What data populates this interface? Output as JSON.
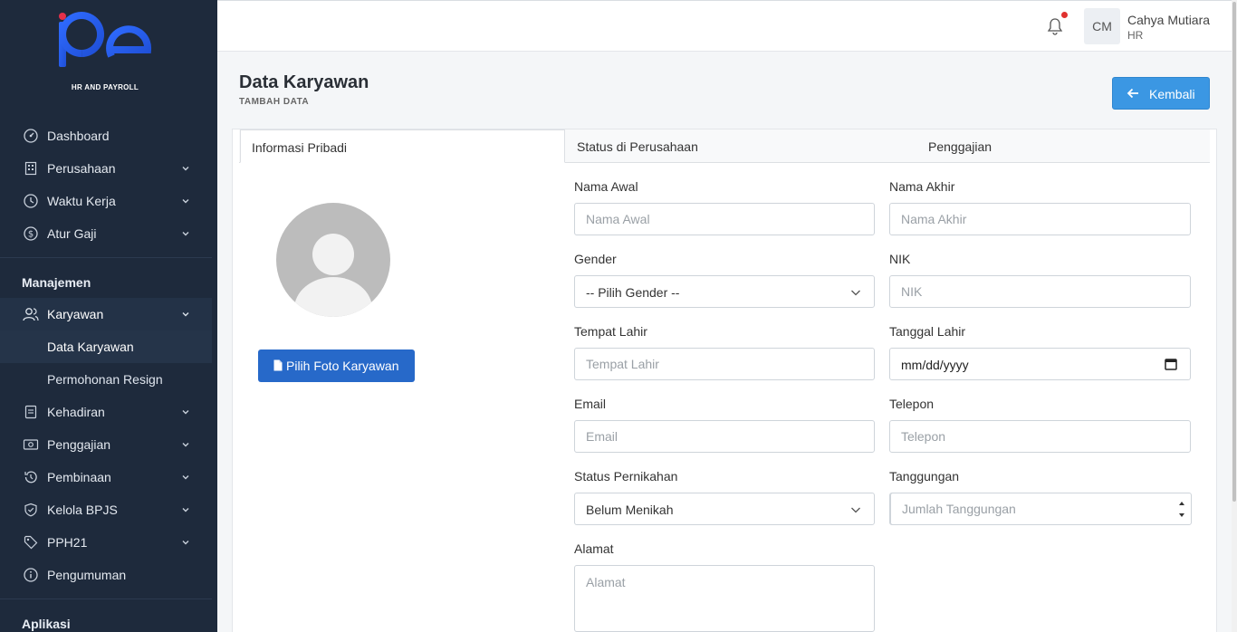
{
  "brand": {
    "logo_text": "be",
    "tagline": "HR AND PAYROLL",
    "accent": "#2563eb"
  },
  "sidebar": {
    "items": [
      {
        "label": "Dashboard",
        "icon": "dashboard-icon"
      },
      {
        "label": "Perusahaan",
        "icon": "building-icon"
      },
      {
        "label": "Waktu Kerja",
        "icon": "clock-icon"
      },
      {
        "label": "Atur Gaji",
        "icon": "dollar-icon"
      }
    ],
    "section_manajemen": "Manajemen",
    "manajemen_items": [
      {
        "label": "Karyawan",
        "icon": "users-icon"
      }
    ],
    "karyawan_sub": [
      {
        "label": "Data Karyawan"
      },
      {
        "label": "Permohonan Resign"
      }
    ],
    "more_items": [
      {
        "label": "Kehadiran",
        "icon": "clipboard-icon"
      },
      {
        "label": "Penggajian",
        "icon": "money-icon"
      },
      {
        "label": "Pembinaan",
        "icon": "history-icon"
      },
      {
        "label": "Kelola BPJS",
        "icon": "shield-icon"
      },
      {
        "label": "PPH21",
        "icon": "tag-icon"
      },
      {
        "label": "Pengumuman",
        "icon": "info-icon"
      }
    ],
    "section_aplikasi": "Aplikasi"
  },
  "topbar": {
    "initials": "CM",
    "user_name": "Cahya Mutiara",
    "user_role": "HR"
  },
  "page": {
    "title": "Data Karyawan",
    "subtitle": "TAMBAH DATA",
    "back_label": "Kembali"
  },
  "tabs": [
    {
      "label": "Informasi Pribadi"
    },
    {
      "label": "Status di Perusahaan"
    },
    {
      "label": "Penggajian"
    }
  ],
  "photo": {
    "button_label": "Pilih Foto Karyawan"
  },
  "form": {
    "nama_awal": {
      "label": "Nama Awal",
      "placeholder": "Nama Awal"
    },
    "nama_akhir": {
      "label": "Nama Akhir",
      "placeholder": "Nama Akhir"
    },
    "gender": {
      "label": "Gender",
      "value": "-- Pilih Gender --"
    },
    "nik": {
      "label": "NIK",
      "placeholder": "NIK"
    },
    "tempat_lahir": {
      "label": "Tempat Lahir",
      "placeholder": "Tempat Lahir"
    },
    "tanggal_lahir": {
      "label": "Tanggal Lahir",
      "value": "mm/dd/yyyy"
    },
    "email": {
      "label": "Email",
      "placeholder": "Email"
    },
    "telepon": {
      "label": "Telepon",
      "placeholder": "Telepon"
    },
    "status_pernikahan": {
      "label": "Status Pernikahan",
      "value": "Belum Menikah"
    },
    "tanggungan": {
      "label": "Tanggungan",
      "placeholder": "Jumlah Tanggungan"
    },
    "alamat": {
      "label": "Alamat",
      "placeholder": "Alamat"
    }
  }
}
